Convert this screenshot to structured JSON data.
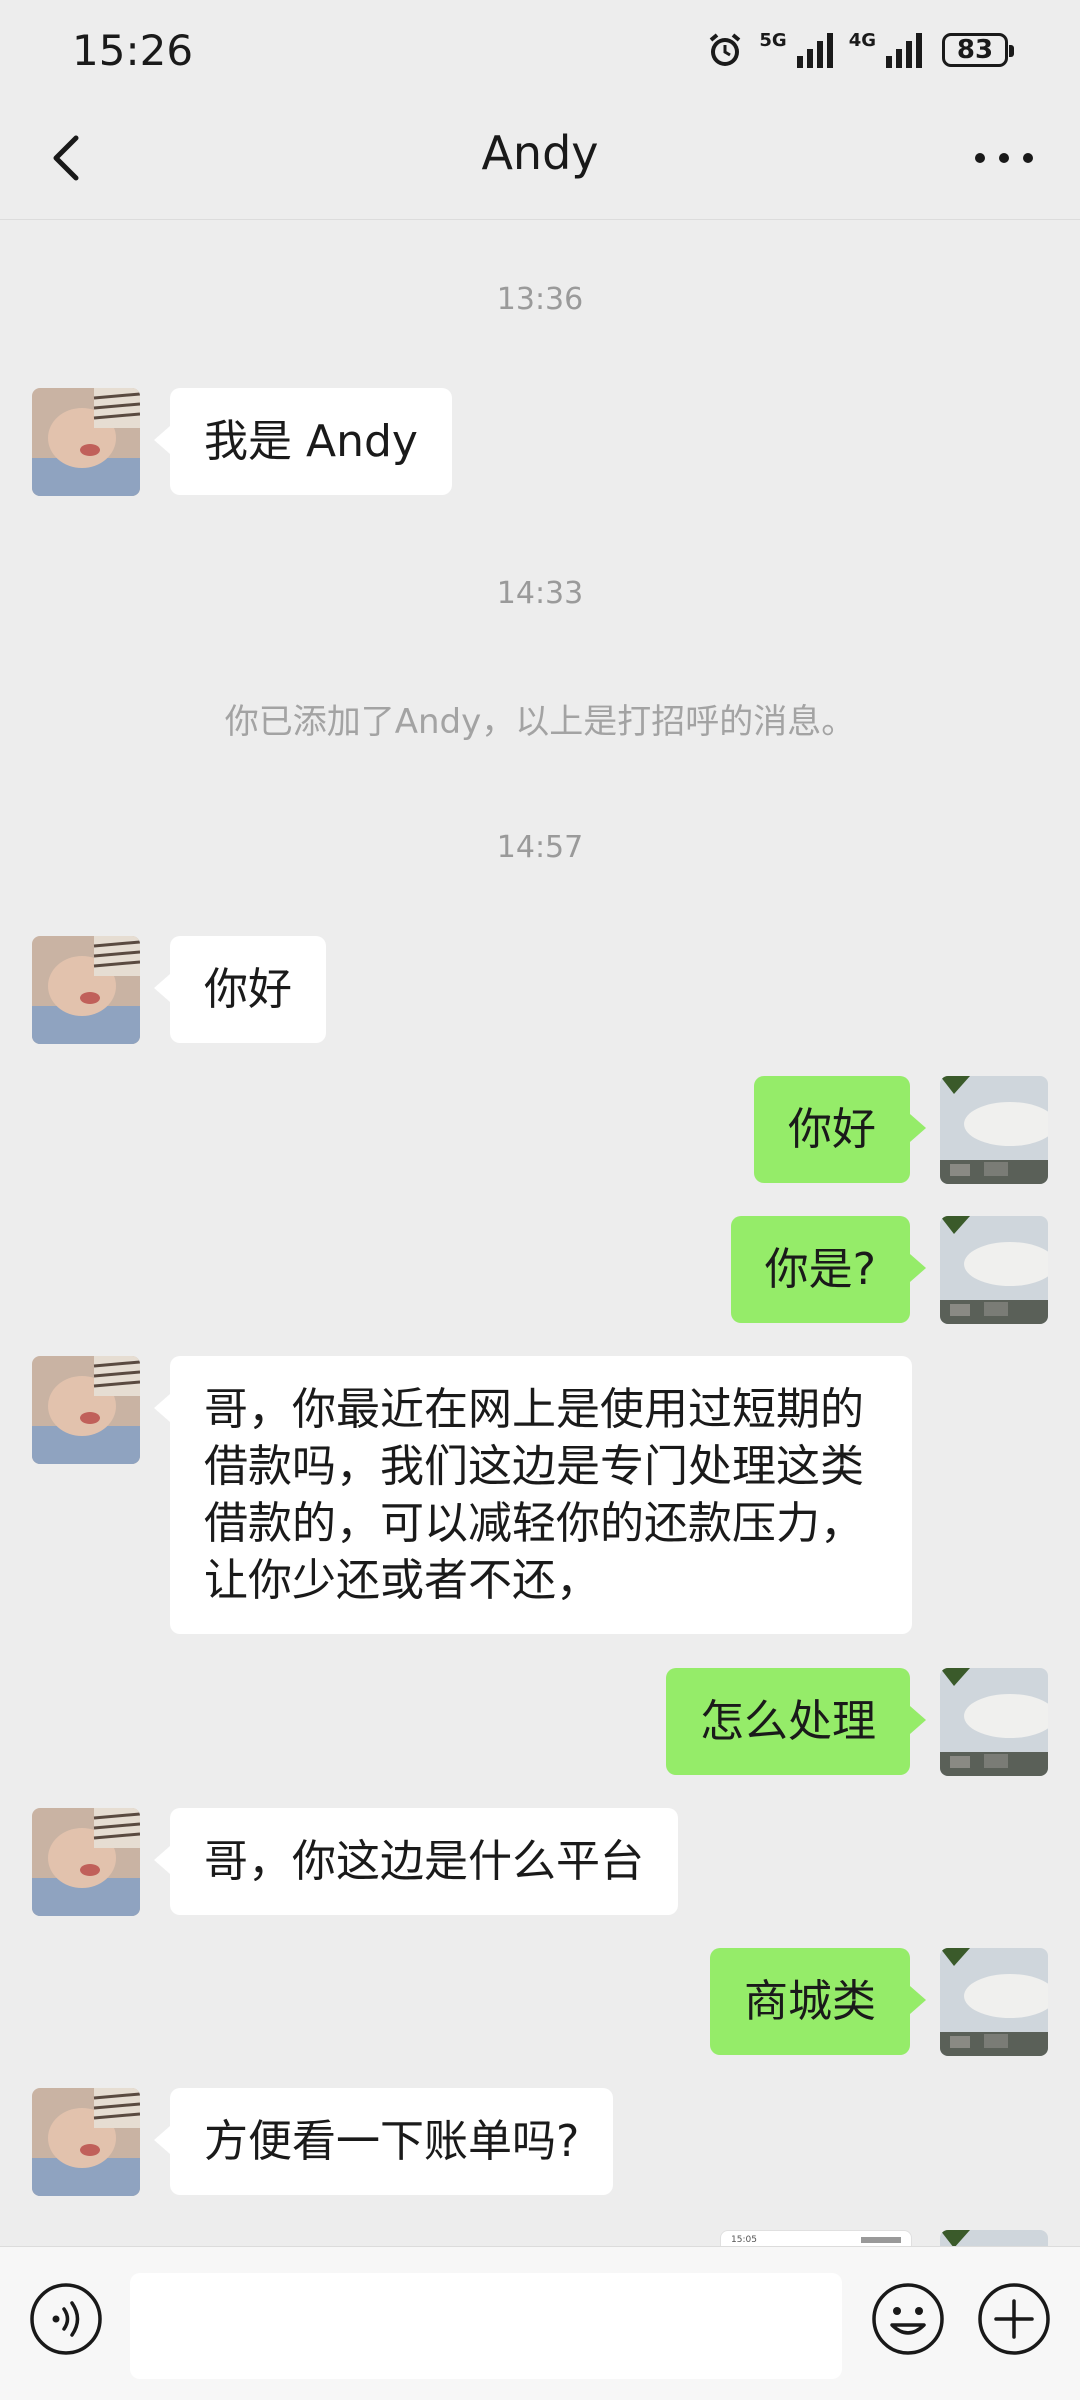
{
  "status_bar": {
    "time": "15:26",
    "network_1": "5G",
    "network_2": "4G",
    "battery": "83",
    "icons": [
      "alarm-icon",
      "signal-icon",
      "signal-icon",
      "battery-icon"
    ]
  },
  "nav": {
    "title": "Andy",
    "back_icon": "chevron-left-icon",
    "more_icon": "more-dots-icon"
  },
  "chat": {
    "timestamps": [
      "13:36",
      "14:33",
      "14:57"
    ],
    "system_note": "你已添加了Andy，以上是打招呼的消息。",
    "messages": [
      {
        "from": "contact",
        "text": "我是 Andy"
      },
      {
        "from": "contact",
        "text": "你好"
      },
      {
        "from": "me",
        "text": "你好"
      },
      {
        "from": "me",
        "text": "你是?"
      },
      {
        "from": "contact",
        "text": "哥，你最近在网上是使用过短期的\n借款吗，我们这边是专门处理这类\n借款的，可以减轻你的还款压力，\n让你少还或者不还，"
      },
      {
        "from": "me",
        "text": "怎么处理"
      },
      {
        "from": "contact",
        "text": "哥，你这边是什么平台"
      },
      {
        "from": "me",
        "text": "商城类"
      },
      {
        "from": "contact",
        "text": "方便看一下账单吗?"
      }
    ],
    "partial_image_caption": "15:05"
  },
  "input_bar": {
    "placeholder": "",
    "icons": [
      "voice-icon",
      "emoji-icon",
      "plus-icon"
    ]
  },
  "colors": {
    "background": "#ededed",
    "outgoing_bubble": "#95ec69",
    "incoming_bubble": "#ffffff"
  }
}
